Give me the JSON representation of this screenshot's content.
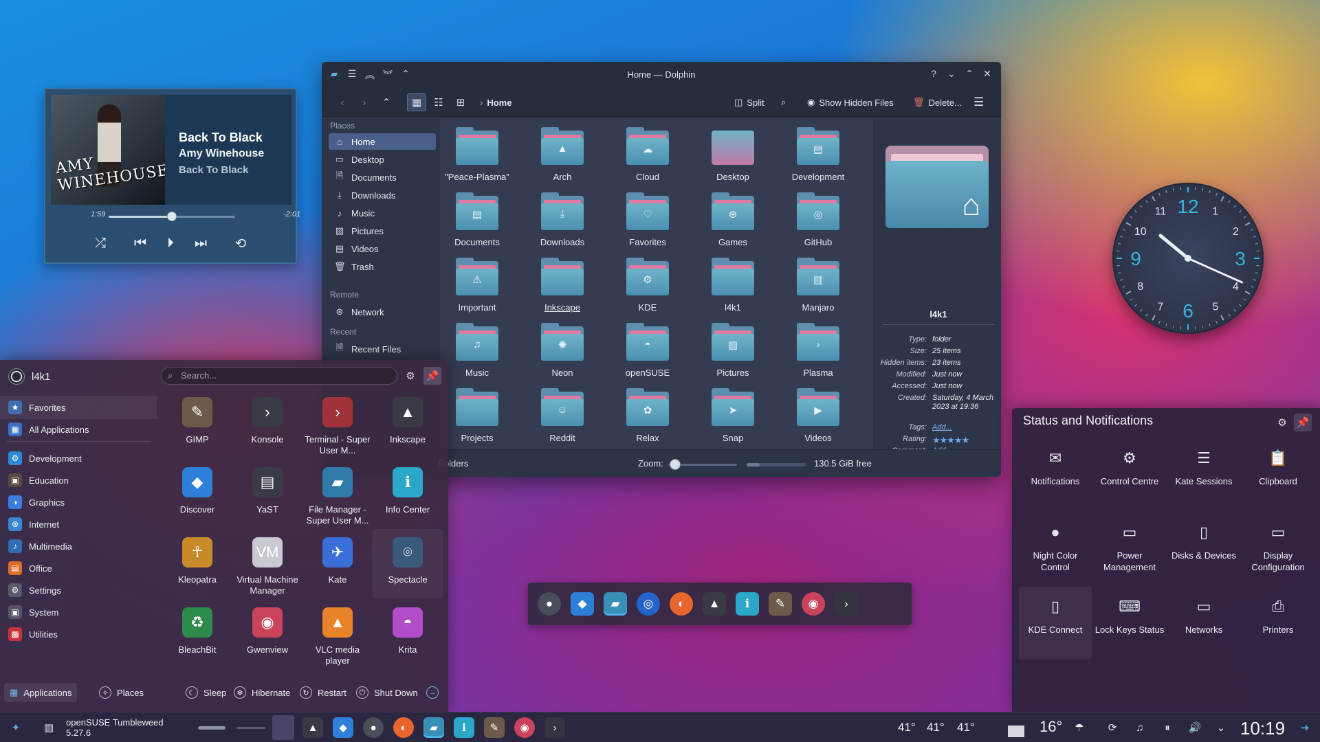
{
  "media_player": {
    "cover_text": "AMY WINEHOUSE",
    "title": "Back To Black",
    "artist": "Amy Winehouse",
    "album": "Back To Black",
    "elapsed": "1:59",
    "remaining": "-2:01",
    "progress": 0.5
  },
  "dolphin": {
    "title": "Home — Dolphin",
    "toolbar": {
      "split": "Split",
      "show_hidden": "Show Hidden Files",
      "delete": "Delete...",
      "breadcrumb": "Home"
    },
    "sidebar": {
      "places_header": "Places",
      "places": [
        "Home",
        "Desktop",
        "Documents",
        "Downloads",
        "Music",
        "Pictures",
        "Videos",
        "Trash"
      ],
      "remote_header": "Remote",
      "remote": [
        "Network"
      ],
      "recent_header": "Recent",
      "recent": [
        "Recent Files"
      ]
    },
    "folders": [
      "\"Peace-Plasma\"",
      "Arch",
      "Cloud",
      "Desktop",
      "Development",
      "Documents",
      "Downloads",
      "Favorites",
      "Games",
      "GitHub",
      "Important",
      "Inkscape",
      "KDE",
      "l4k1",
      "Manjaro",
      "Music",
      "Neon",
      "openSUSE",
      "Pictures",
      "Plasma",
      "Projects",
      "Reddit",
      "Relax",
      "Snap",
      "Videos"
    ],
    "info": {
      "name": "l4k1",
      "type_label": "Type:",
      "type": "folder",
      "size_label": "Size:",
      "size": "25 items",
      "hidden_label": "Hidden items:",
      "hidden": "23 items",
      "modified_label": "Modified:",
      "modified": "Just now",
      "accessed_label": "Accessed:",
      "accessed": "Just now",
      "created_label": "Created:",
      "created": "Saturday, 4 March 2023 at 19:36",
      "tags_label": "Tags:",
      "tags": "Add...",
      "rating_label": "Rating:",
      "rating": 5,
      "comment_label": "Comment:",
      "comment": "Add..."
    },
    "status": {
      "folders": "Folders",
      "zoom_label": "Zoom:",
      "free": "130.5 GiB free",
      "disk_used": 0.22
    }
  },
  "clock": {
    "numbers": [
      "12",
      "1",
      "2",
      "3",
      "4",
      "5",
      "6",
      "7",
      "8",
      "9",
      "10",
      "11"
    ],
    "hour": 10,
    "minute": 19
  },
  "launcher": {
    "user": "l4k1",
    "search_placeholder": "Search...",
    "categories": [
      "Favorites",
      "All Applications",
      "Development",
      "Education",
      "Graphics",
      "Internet",
      "Multimedia",
      "Office",
      "Settings",
      "System",
      "Utilities"
    ],
    "apps": [
      "GIMP",
      "Konsole",
      "Terminal - Super User M...",
      "Inkscape",
      "Discover",
      "YaST",
      "File Manager - Super User M...",
      "Info Center",
      "Kleopatra",
      "Virtual Machine Manager",
      "Kate",
      "Spectacle",
      "BleachBit",
      "Gwenview",
      "VLC media player",
      "Krita"
    ],
    "footer": {
      "applications": "Applications",
      "places": "Places",
      "sleep": "Sleep",
      "hibernate": "Hibernate",
      "restart": "Restart",
      "shutdown": "Shut Down"
    }
  },
  "status_notifications": {
    "title": "Status and Notifications",
    "items": [
      "Notifications",
      "Control Centre",
      "Kate Sessions",
      "Clipboard",
      "Night Color Control",
      "Power Management",
      "Disks & Devices",
      "Display Configuration",
      "KDE Connect",
      "Lock Keys Status",
      "Networks",
      "Printers"
    ]
  },
  "taskbar": {
    "window_title": "openSUSE Tumbleweed 5.27.6",
    "temps": [
      "41°",
      "41°",
      "41°"
    ],
    "weather": "16°",
    "time": "10:19"
  },
  "colors": {
    "accent": "#4fb0e8",
    "folder": "#5e8fae",
    "clock_accent": "#36b6e0"
  }
}
